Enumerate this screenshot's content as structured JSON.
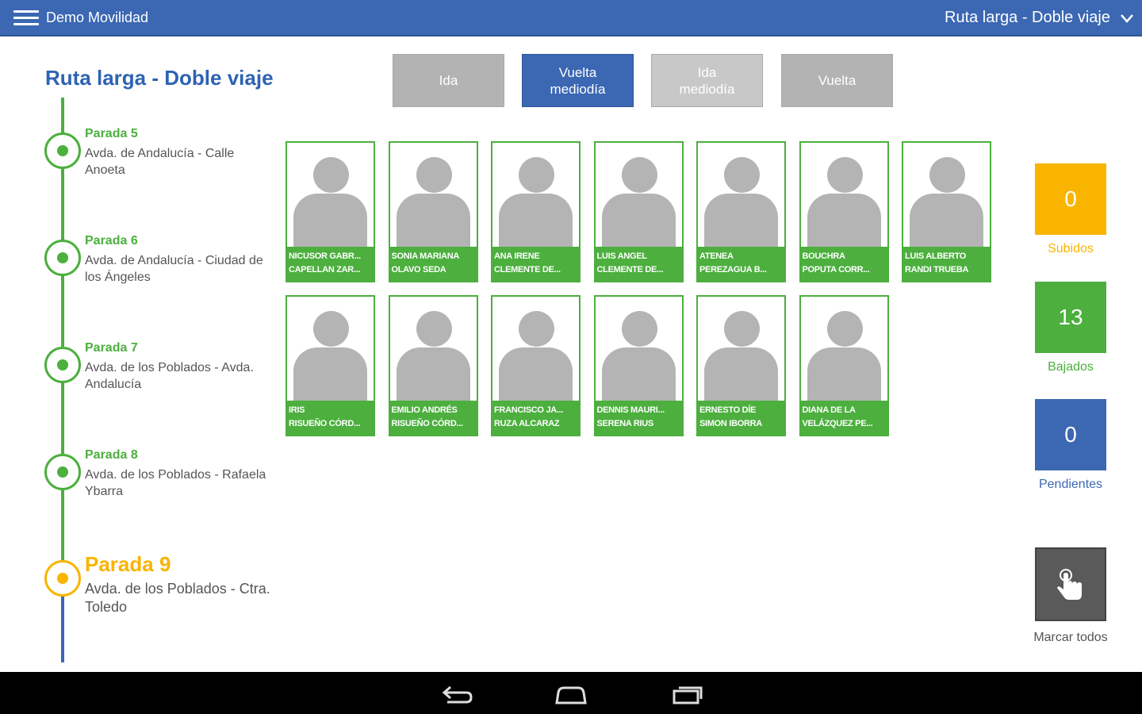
{
  "appbar": {
    "title": "Demo Movilidad",
    "route_selector": "Ruta larga - Doble viaje",
    "color": "#3b67b3"
  },
  "route": {
    "title": "Ruta larga - Doble viaje",
    "stops": [
      {
        "name": "Parada 5",
        "address": "Avda. de Andalucía - Calle Anoeta",
        "status": "done"
      },
      {
        "name": "Parada 6",
        "address": "Avda. de Andalucía - Ciudad de los Ángeles",
        "status": "done"
      },
      {
        "name": "Parada 7",
        "address": "Avda. de los Poblados - Avda. Andalucía",
        "status": "done"
      },
      {
        "name": "Parada 8",
        "address": "Avda. de los Poblados - Rafaela Ybarra",
        "status": "done"
      },
      {
        "name": "Parada 9",
        "address": "Avda. de los Poblados - Ctra. Toledo",
        "status": "current"
      }
    ]
  },
  "tabs": [
    {
      "label": "Ida",
      "state": "inactive"
    },
    {
      "label": "Vuelta mediodía",
      "state": "active"
    },
    {
      "label": "Ida mediodía",
      "state": "inactive"
    },
    {
      "label": "Vuelta",
      "state": "inactive"
    }
  ],
  "passengers": [
    {
      "line1": "NICUSOR GABR...",
      "line2": "CAPELLAN ZAR..."
    },
    {
      "line1": "SONIA MARIANA",
      "line2": "OLAVO SEDA"
    },
    {
      "line1": "ANA IRENE",
      "line2": "CLEMENTE DE..."
    },
    {
      "line1": "LUIS ANGEL",
      "line2": "CLEMENTE DE..."
    },
    {
      "line1": "ATENEA",
      "line2": "PEREZAGUA B..."
    },
    {
      "line1": "BOUCHRA",
      "line2": "POPUTA CORR..."
    },
    {
      "line1": "LUIS ALBERTO",
      "line2": "RANDI TRUEBA"
    },
    {
      "line1": "IRIS",
      "line2": "RISUEÑO CÓRD..."
    },
    {
      "line1": "EMILIO ANDRÉS",
      "line2": "RISUEÑO CÓRD..."
    },
    {
      "line1": "FRANCISCO JA...",
      "line2": "RUZA ALCARAZ"
    },
    {
      "line1": "DENNIS MAURI...",
      "line2": "SERENA RIUS"
    },
    {
      "line1": "ERNESTO DÍE",
      "line2": "SIMON IBORRA"
    },
    {
      "line1": "DIANA DE LA",
      "line2": "VELÁZQUEZ PE..."
    }
  ],
  "counters": [
    {
      "value": "0",
      "label": "Subidos",
      "color": "#f9b400"
    },
    {
      "value": "13",
      "label": "Bajados",
      "color": "#4caf3e"
    },
    {
      "value": "0",
      "label": "Pendientes",
      "color": "#3b67b3"
    }
  ],
  "mark_all": {
    "label": "Marcar todos",
    "icon": "hand-pointer-icon"
  },
  "navbar": {
    "icons": [
      "back-icon",
      "home-icon",
      "recents-icon"
    ]
  }
}
